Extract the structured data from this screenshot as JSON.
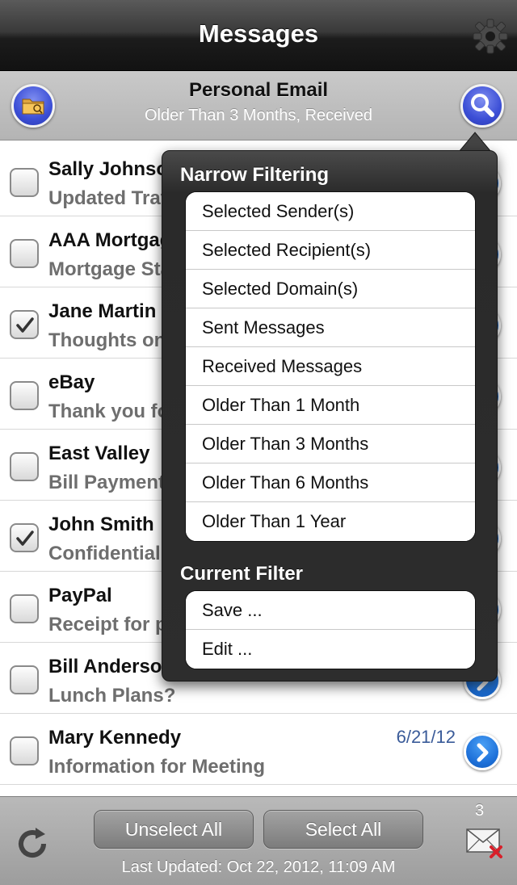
{
  "nav": {
    "title": "Messages"
  },
  "subheader": {
    "title": "Personal Email",
    "subtitle": "Older Than 3 Months, Received"
  },
  "messages": [
    {
      "sender": "Sally Johnson",
      "subject": "Updated Travel Plans",
      "date": "",
      "checked": false
    },
    {
      "sender": "AAA Mortgage",
      "subject": "Mortgage Statement",
      "date": "",
      "checked": false
    },
    {
      "sender": "Jane Martin",
      "subject": "Thoughts on proposal",
      "date": "",
      "checked": true
    },
    {
      "sender": "eBay",
      "subject": "Thank you for your purchase",
      "date": "",
      "checked": false
    },
    {
      "sender": "East Valley",
      "subject": "Bill Payment",
      "date": "",
      "checked": false
    },
    {
      "sender": "John Smith",
      "subject": "Confidential",
      "date": "",
      "checked": true
    },
    {
      "sender": "PayPal",
      "subject": "Receipt for payment",
      "date": "",
      "checked": false
    },
    {
      "sender": "Bill Anderson",
      "subject": "Lunch Plans?",
      "date": "",
      "checked": false
    },
    {
      "sender": "Mary Kennedy",
      "subject": "Information for Meeting",
      "date": "6/21/12",
      "checked": false
    }
  ],
  "popover": {
    "narrow_title": "Narrow Filtering",
    "narrow_items": [
      "Selected Sender(s)",
      "Selected Recipient(s)",
      "Selected Domain(s)",
      "Sent Messages",
      "Received Messages",
      "Older Than 1 Month",
      "Older Than 3 Months",
      "Older Than 6 Months",
      "Older Than 1 Year"
    ],
    "current_title": "Current Filter",
    "current_items": [
      "Save ...",
      "Edit ..."
    ]
  },
  "toolbar": {
    "unselect_label": "Unselect All",
    "select_label": "Select All",
    "last_updated": "Last Updated: Oct 22, 2012, 11:09 AM",
    "delete_count": "3"
  },
  "colors": {
    "accent_blue": "#3c4fd6",
    "disclosure_blue": "#1c6fd8",
    "date_blue": "#3a5b99"
  },
  "icons": {
    "settings": "gear-icon",
    "folder": "folder-icon",
    "search": "search-icon",
    "refresh": "refresh-icon",
    "delete": "mail-delete-icon",
    "disclosure": "chevron-right-icon",
    "checkbox": "checkmark-icon"
  }
}
